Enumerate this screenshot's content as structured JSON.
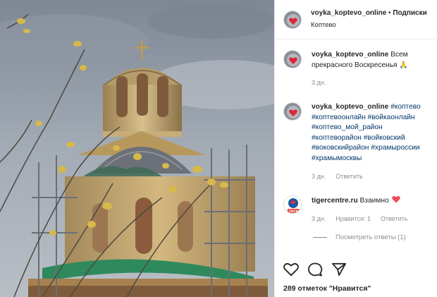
{
  "post": {
    "username": "voyka_koptevo_online",
    "separator": "•",
    "subscribe_label": "Подписки",
    "location": "Коптево"
  },
  "comments": [
    {
      "username": "voyka_koptevo_online",
      "text": "Всем прекрасного Воскресенья 🙏",
      "time": "3 дн."
    },
    {
      "username": "voyka_koptevo_online",
      "hashtags": [
        "#коптево",
        "#коптевоонлайн",
        "#войкаонлайн",
        "#коптево_мой_район",
        "#коптеворайон",
        "#войковский",
        "#воковскийрайон",
        "#храмыроссии",
        "#храмымосквы"
      ],
      "time": "3 дн.",
      "reply_label": "Ответить"
    },
    {
      "username": "tigercentre.ru",
      "avatar_caption": "ТИГР",
      "text": "Взаимно",
      "time": "3 дн.",
      "likes_label": "Нравится: 1",
      "reply_label": "Ответить"
    }
  ],
  "view_replies_label": "Посмотреть ответы (1)",
  "likes_text": "289 отметок \"Нравится\"",
  "icons": {
    "like": "heart-icon",
    "comment": "comment-icon",
    "share": "share-icon",
    "verified_heart": "red-heart-icon"
  },
  "colors": {
    "hashtag": "#00376b",
    "muted": "#8e8e8e",
    "heart": "#ed4956"
  }
}
